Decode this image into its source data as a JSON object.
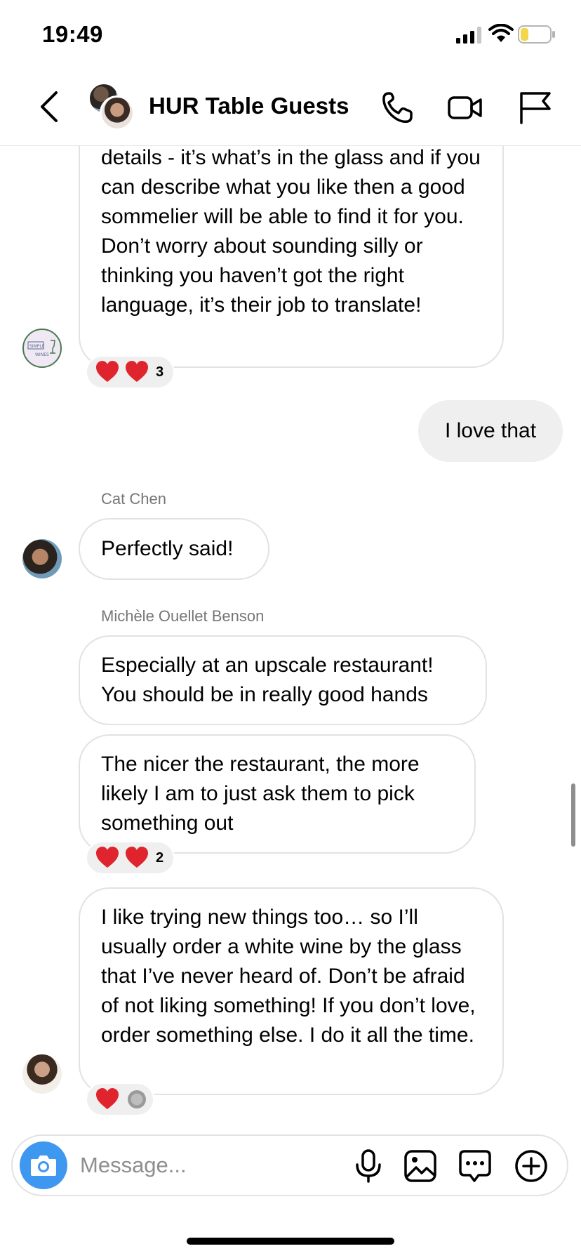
{
  "status_bar": {
    "time": "19:49",
    "battery_color": "#f2d64b"
  },
  "header": {
    "title": "HUR Table Guests",
    "icons": [
      "chevron-left-icon",
      "phone-icon",
      "video-camera-icon",
      "flag-icon"
    ]
  },
  "messages": [
    {
      "id": "m1",
      "sender": "",
      "text": "details - it’s what’s in the glass and if you can describe what you like then a good sommelier will be able to find it for you. Don’t worry about sounding silly or thinking you haven’t got the right language, it’s their job to translate!",
      "reactions": {
        "emojis": [
          "red-heart",
          "red-heart"
        ],
        "count": "3"
      }
    },
    {
      "id": "m2",
      "sender": "self",
      "text": "I love that"
    },
    {
      "id": "m3",
      "sender": "Cat Chen",
      "text": "Perfectly said!"
    },
    {
      "id": "m4",
      "sender": "Michèle Ouellet Benson",
      "text": "Especially at an upscale restaurant! You should be in really good hands"
    },
    {
      "id": "m5",
      "sender": "Michèle Ouellet Benson",
      "text": "The nicer the restaurant, the more likely I am to just ask them to pick something out",
      "reactions": {
        "emojis": [
          "red-heart",
          "red-heart"
        ],
        "count": "2"
      }
    },
    {
      "id": "m6",
      "sender": "Michèle Ouellet Benson",
      "text": "I like trying new things too… so I’ll usually order a white wine by the glass that I’ve never heard of. Don’t be afraid of not liking something! If you don’t love, order something else. I do it all the time.",
      "reactions": {
        "emojis": [
          "red-heart",
          "grey-circle"
        ],
        "count": ""
      }
    }
  ],
  "composer": {
    "placeholder": "Message...",
    "value": "",
    "icons": [
      "camera-icon",
      "microphone-icon",
      "image-icon",
      "sticker-icon",
      "plus-icon"
    ],
    "camera_color": "#3f98f0"
  },
  "colors": {
    "heart": "#e0242d",
    "own_bubble": "#efefef",
    "bubble_border": "#e2e2e2"
  }
}
